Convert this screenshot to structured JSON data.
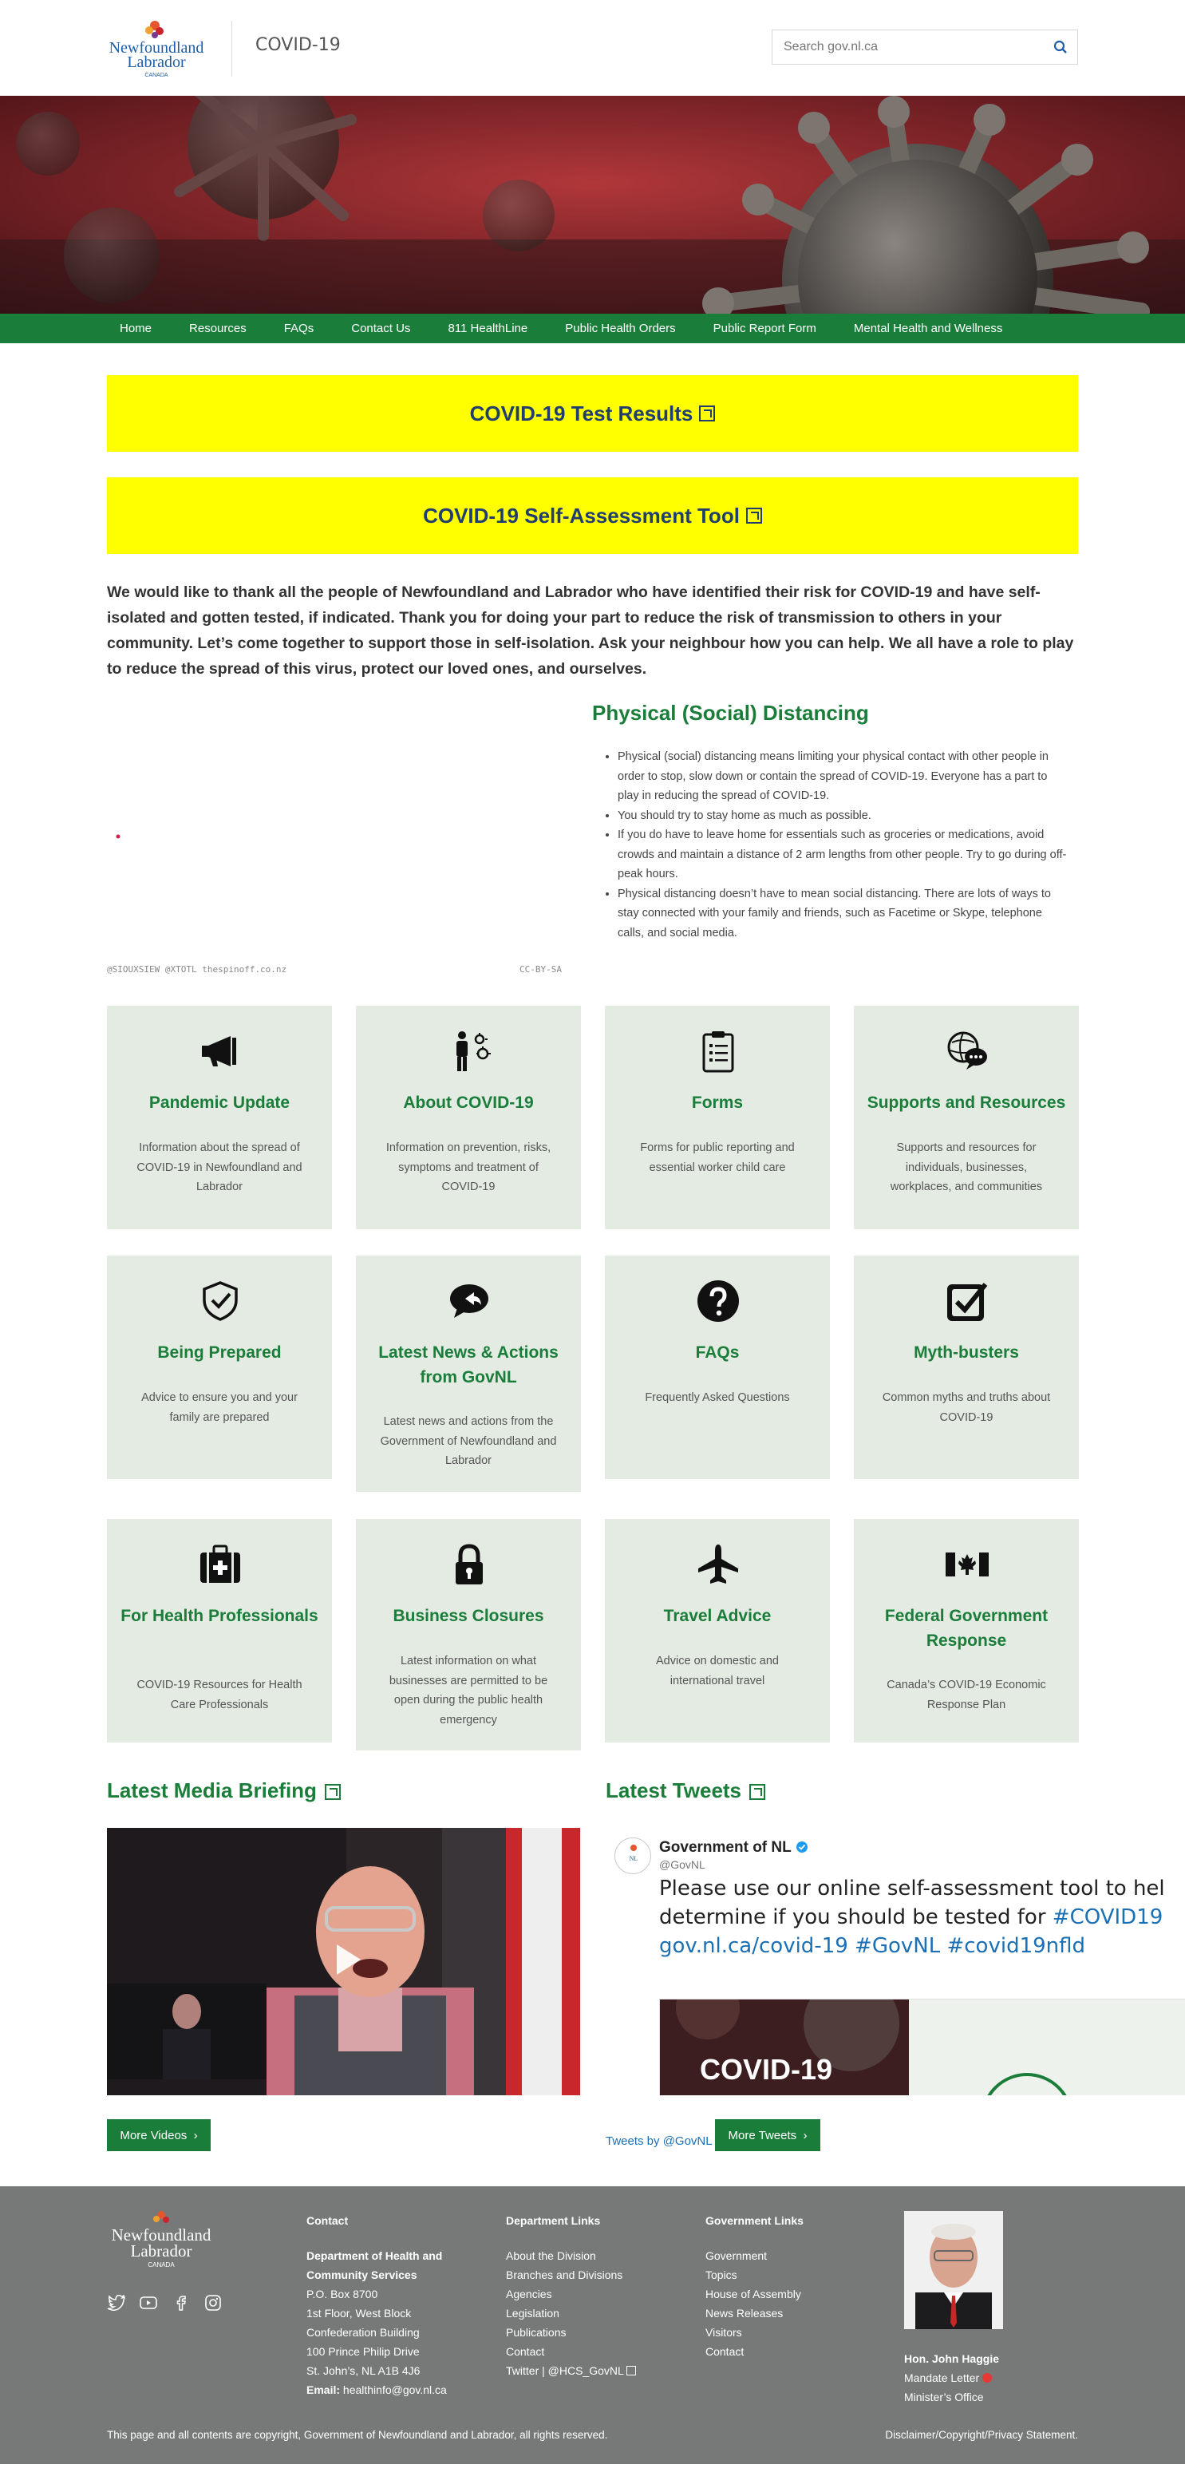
{
  "header": {
    "site_title": "COVID-19",
    "search_placeholder": "Search gov.nl.ca",
    "logo_text_line1": "Newfoundland",
    "logo_text_line2": "Labrador",
    "logo_text_line3": "CANADA"
  },
  "nav": {
    "items": [
      "Home",
      "Resources",
      "FAQs",
      "Contact Us",
      "811 HealthLine",
      "Public Health Orders",
      "Public Report Form",
      "Mental Health and Wellness"
    ]
  },
  "banners": {
    "test_results": "COVID-19 Test Results",
    "self_assessment": "COVID-19 Self-Assessment Tool"
  },
  "intro": "We would like to thank all the people of Newfoundland and Labrador who have identified their risk for COVID-19 and have self-isolated and gotten tested, if indicated. Thank you for doing your part to reduce the risk of transmission to others in your community. Let’s come together to support those in self-isolation. Ask your neighbour how you can help. We all have a role to play to reduce the spread of this virus, protect our loved ones, and ourselves.",
  "distancing": {
    "title": "Physical (Social) Distancing",
    "image_credit": "@SIOUXSIEW @XTOTL thespinoff.co.nz",
    "image_license": "CC-BY-SA",
    "bullets": [
      "Physical (social) distancing means limiting your physical contact with other people in order to stop, slow down or contain the spread of COVID-19. Everyone has a part to play in reducing the spread of COVID-19.",
      "You should try to stay home as much as possible.",
      "If you do have to leave home for essentials such as groceries or medications, avoid crowds and maintain a distance of 2 arm lengths from other people. Try to go during off-peak hours.",
      "Physical distancing doesn’t have to mean social distancing. There are lots of ways to stay connected with your family and friends, such as Facetime or Skype, telephone calls, and social media."
    ]
  },
  "cards": [
    {
      "title": "Pandemic Update",
      "desc": "Information about the spread of COVID-19 in Newfoundland and Labrador",
      "icon": "megaphone-icon"
    },
    {
      "title": "About COVID-19",
      "desc": "Information on prevention, risks, symptoms and treatment of COVID-19",
      "icon": "person-virus-icon"
    },
    {
      "title": "Forms",
      "desc": "Forms for public reporting and essential worker child care",
      "icon": "clipboard-icon"
    },
    {
      "title": "Supports and Resources",
      "desc": "Supports and resources for individuals, businesses, workplaces, and communities",
      "icon": "globe-chat-icon"
    },
    {
      "title": "Being Prepared",
      "desc": "Advice to ensure you and your family are prepared",
      "icon": "shield-check-icon"
    },
    {
      "title": "Latest News & Actions from GovNL",
      "desc": "Latest news and actions from the Government of Newfoundland and Labrador",
      "icon": "speech-reply-icon"
    },
    {
      "title": "FAQs",
      "desc": "Frequently Asked Questions",
      "icon": "question-icon"
    },
    {
      "title": "Myth-busters",
      "desc": "Common myths and truths about COVID-19",
      "icon": "checkbox-icon"
    },
    {
      "title": "For Health Professionals",
      "desc": "COVID-19 Resources for Health Care Professionals",
      "icon": "medical-kit-icon"
    },
    {
      "title": "Business Closures",
      "desc": "Latest information on what businesses are permitted to be open during the public health emergency",
      "icon": "lock-icon"
    },
    {
      "title": "Travel Advice",
      "desc": "Advice on domestic and international travel",
      "icon": "airplane-icon"
    },
    {
      "title": "Federal Government Response",
      "desc": "Canada’s COVID-19 Economic Response Plan",
      "icon": "canada-flag-icon"
    }
  ],
  "media": {
    "title": "Latest Media Briefing",
    "more_videos": "More Videos"
  },
  "tweets": {
    "title": "Latest Tweets",
    "account_name": "Government of NL",
    "handle": "@GovNL",
    "text_plain": "Please use our online self-assessment tool to hel",
    "text_line2_plain": "determine if you should be tested for ",
    "text_line2_tag": "#COVID19",
    "text_line3": "gov.nl.ca/covid-19 #GovNL #covid19nfld",
    "media_title": "COVID-19",
    "tweets_by": "Tweets by @GovNL",
    "more_tweets": "More Tweets"
  },
  "footer": {
    "contact": {
      "heading": "Contact",
      "dept_line1": "Department of Health and",
      "dept_line2": "Community Services",
      "lines": [
        "P.O. Box 8700",
        "1st Floor, West Block",
        "Confederation Building",
        "100 Prince Philip Drive",
        "St. John’s, NL A1B 4J6"
      ],
      "email_label": "Email:",
      "email": "healthinfo@gov.nl.ca"
    },
    "dept_links": {
      "heading": "Department Links",
      "items": [
        "About the Division",
        "Branches and Divisions",
        "Agencies",
        "Legislation",
        "Publications",
        "Contact",
        "Twitter | @HCS_GovNL"
      ]
    },
    "gov_links": {
      "heading": "Government Links",
      "items": [
        "Government",
        "Topics",
        "House of Assembly",
        "News Releases",
        "Visitors",
        "Contact"
      ]
    },
    "minister": {
      "name": "Hon. John Haggie",
      "mandate": "Mandate Letter",
      "office": "Minister’s Office"
    },
    "copyright": "This page and all contents are copyright, Government of Newfoundland and Labrador, all rights reserved.",
    "disclaimer": "Disclaimer/Copyright/Privacy Statement."
  }
}
